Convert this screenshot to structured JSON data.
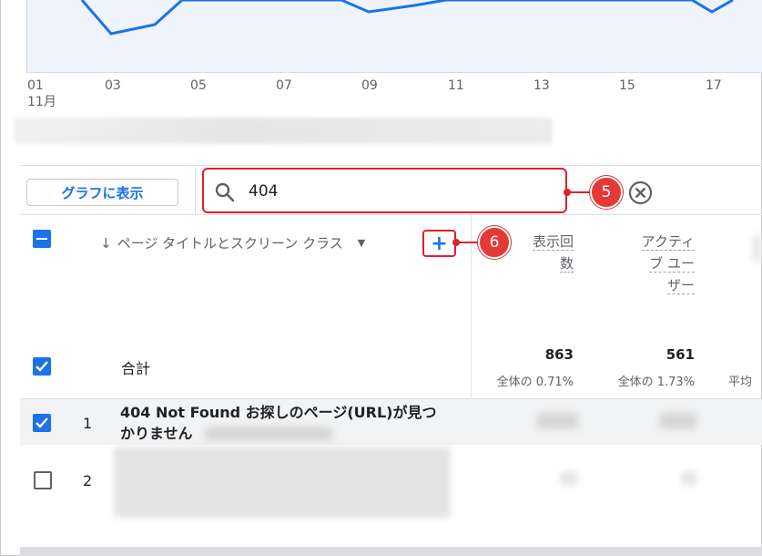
{
  "chart": {
    "x_ticks": [
      "01",
      "03",
      "05",
      "07",
      "09",
      "11",
      "13",
      "15",
      "17"
    ],
    "x_sub": "11月",
    "line_color": "#1a73e8"
  },
  "toolbar": {
    "graph_button": "グラフに表示",
    "search_value": "404",
    "callout_search": "5",
    "callout_add": "6"
  },
  "table": {
    "dimension_header": "ページ タイトルとスクリーン クラス",
    "metrics": [
      {
        "label_lines": [
          "表示回",
          "数"
        ]
      },
      {
        "label_lines": [
          "アクティ",
          "ブ ユー",
          "ザー"
        ]
      }
    ],
    "total": {
      "label": "合計",
      "values": [
        "863",
        "561"
      ],
      "subs": [
        "全体の 0.71%",
        "全体の 1.73%",
        "平均"
      ]
    },
    "rows": [
      {
        "num": "1",
        "title_line1": "404 Not Found お探しのページ(URL)が見つ",
        "title_line2": "かりません"
      },
      {
        "num": "2"
      }
    ]
  },
  "colors": {
    "accent": "#1a73e8",
    "callout": "#e53935"
  }
}
